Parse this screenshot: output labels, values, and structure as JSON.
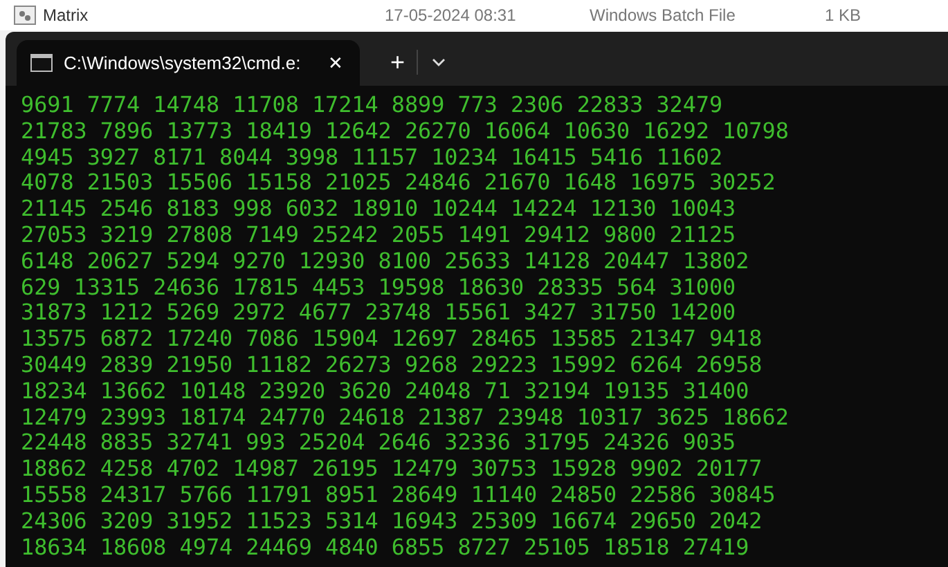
{
  "file_row": {
    "name": "Matrix",
    "modified": "17-05-2024 08:31",
    "type": "Windows Batch File",
    "size": "1 KB"
  },
  "tabs": [
    {
      "title": "C:\\Windows\\system32\\cmd.e:",
      "close": "✕",
      "selected": true
    }
  ],
  "new_tab": "+",
  "terminal_lines": [
    "9691 7774 14748 11708 17214 8899 773 2306 22833 32479",
    "21783 7896 13773 18419 12642 26270 16064 10630 16292 10798",
    "4945 3927 8171 8044 3998 11157 10234 16415 5416 11602",
    "4078 21503 15506 15158 21025 24846 21670 1648 16975 30252",
    "21145 2546 8183 998 6032 18910 10244 14224 12130 10043",
    "27053 3219 27808 7149 25242 2055 1491 29412 9800 21125",
    "6148 20627 5294 9270 12930 8100 25633 14128 20447 13802",
    "629 13315 24636 17815 4453 19598 18630 28335 564 31000",
    "31873 1212 5269 2972 4677 23748 15561 3427 31750 14200",
    "13575 6872 17240 7086 15904 12697 28465 13585 21347 9418",
    "30449 2839 21950 11182 26273 9268 29223 15992 6264 26958",
    "18234 13662 10148 23920 3620 24048 71 32194 19135 31400",
    "12479 23993 18174 24770 24618 21387 23948 10317 3625 18662",
    "22448 8835 32741 993 25204 2646 32336 31795 24326 9035",
    "18862 4258 4702 14987 26195 12479 30753 15928 9902 20177",
    "15558 24317 5766 11791 8951 28649 11140 24850 22586 30845",
    "24306 3209 31952 11523 5314 16943 25309 16674 29650 2042",
    "18634 18608 4974 24469 4840 6855 8727 25105 18518 27419"
  ]
}
